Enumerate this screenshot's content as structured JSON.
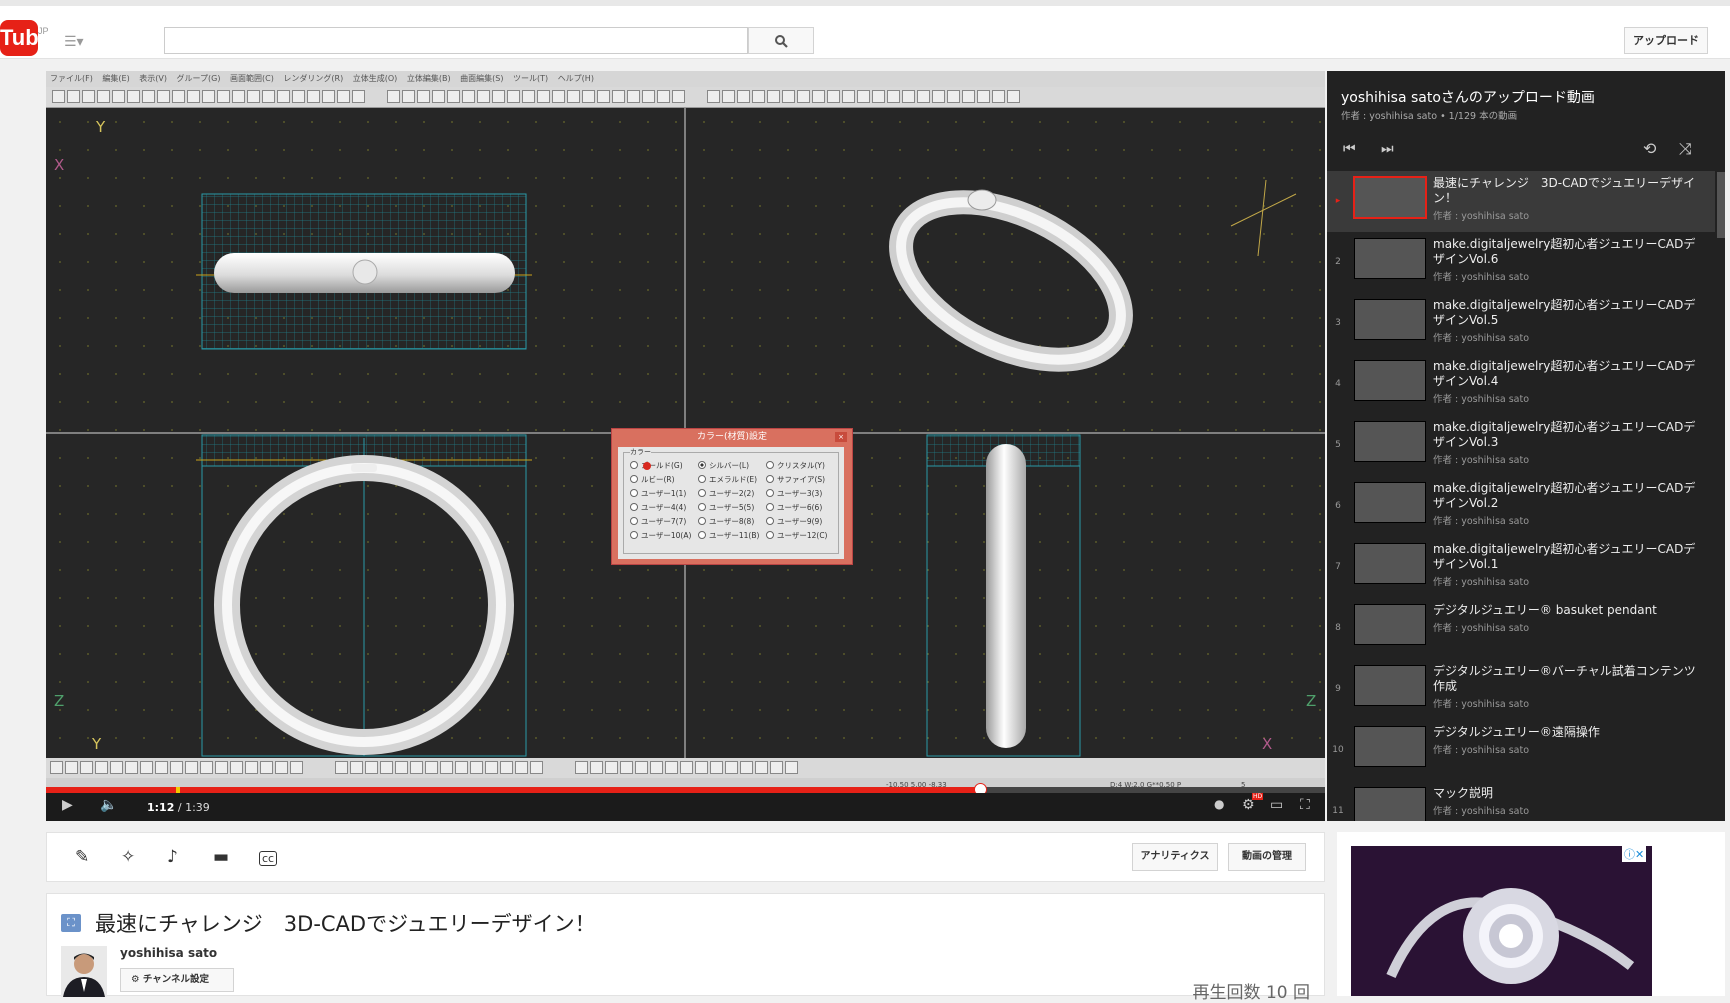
{
  "masthead": {
    "logo_text": "Tube",
    "region": "JP",
    "search_placeholder": "",
    "upload_label": "アップロード"
  },
  "cad": {
    "menu": [
      "ファイル(F)",
      "編集(E)",
      "表示(V)",
      "グループ(G)",
      "画面範囲(C)",
      "レンダリング(R)",
      "立体生成(O)",
      "立体編集(B)",
      "曲面編集(S)",
      "ツール(T)",
      "ヘルプ(H)"
    ],
    "axes": {
      "top_left": [
        "Y",
        "X"
      ],
      "bottom_left": [
        "Z",
        "Y"
      ],
      "bottom_right": [
        "Z",
        "X"
      ]
    },
    "status_text": "-10.50 5.00 -8.33",
    "status_text2": "D:4 W:2.0 G**0.50 P",
    "status_text3": "5"
  },
  "dialog": {
    "title": "カラー(材質)設定",
    "close": "×",
    "group_label": "カラー",
    "options": [
      [
        "ゴールド(G)",
        "シルバー(L)",
        "クリスタル(Y)"
      ],
      [
        "ルビー(R)",
        "エメラルド(E)",
        "サファイア(S)"
      ],
      [
        "ユーザー1(1)",
        "ユーザー2(2)",
        "ユーザー3(3)"
      ],
      [
        "ユーザー4(4)",
        "ユーザー5(5)",
        "ユーザー6(6)"
      ],
      [
        "ユーザー7(7)",
        "ユーザー8(8)",
        "ユーザー9(9)"
      ],
      [
        "ユーザー10(A)",
        "ユーザー11(B)",
        "ユーザー12(C)"
      ]
    ],
    "selected": "シルバー(L)"
  },
  "player": {
    "current_time": "1:12",
    "duration": "/ 1:39",
    "progress": 0.73,
    "hd_badge": "HD"
  },
  "playlist": {
    "title": "yoshihisa satoさんのアップロード動画",
    "subtitle": "作者 : yoshihisa sato • 1/129 本の動画",
    "items": [
      {
        "num": "▸",
        "name": "最速にチャレンジ　3D-CADでジュエリーデザイン！",
        "author": "作者 : yoshihisa sato"
      },
      {
        "num": "2",
        "name": "make.digitaljewelry超初心者ジュエリーCADデザインVol.6",
        "author": "作者 : yoshihisa sato"
      },
      {
        "num": "3",
        "name": "make.digitaljewelry超初心者ジュエリーCADデザインVol.5",
        "author": "作者 : yoshihisa sato"
      },
      {
        "num": "4",
        "name": "make.digitaljewelry超初心者ジュエリーCADデザインVol.4",
        "author": "作者 : yoshihisa sato"
      },
      {
        "num": "5",
        "name": "make.digitaljewelry超初心者ジュエリーCADデザインVol.3",
        "author": "作者 : yoshihisa sato"
      },
      {
        "num": "6",
        "name": "make.digitaljewelry超初心者ジュエリーCADデザインVol.2",
        "author": "作者 : yoshihisa sato"
      },
      {
        "num": "7",
        "name": "make.digitaljewelry超初心者ジュエリーCADデザインVol.1",
        "author": "作者 : yoshihisa sato"
      },
      {
        "num": "8",
        "name": "デジタルジュエリー® basuket pendant",
        "author": "作者 : yoshihisa sato"
      },
      {
        "num": "9",
        "name": "デジタルジュエリー®バーチャル試着コンテンツ作成",
        "author": "作者 : yoshihisa sato"
      },
      {
        "num": "10",
        "name": "デジタルジュエリー®遠隔操作",
        "author": "作者 : yoshihisa sato"
      },
      {
        "num": "11",
        "name": "マック説明",
        "author": "作者 : yoshihisa sato"
      }
    ]
  },
  "actions": {
    "analytics_label": "アナリティクス",
    "manage_label": "動画の管理"
  },
  "video": {
    "title": "最速にチャレンジ　3D-CADでジュエリーデザイン！",
    "author": "yoshihisa sato",
    "channel_settings_label": "チャンネル設定",
    "views": "再生回数 10 回"
  },
  "ad": {
    "badge": "ⓘ✕"
  }
}
